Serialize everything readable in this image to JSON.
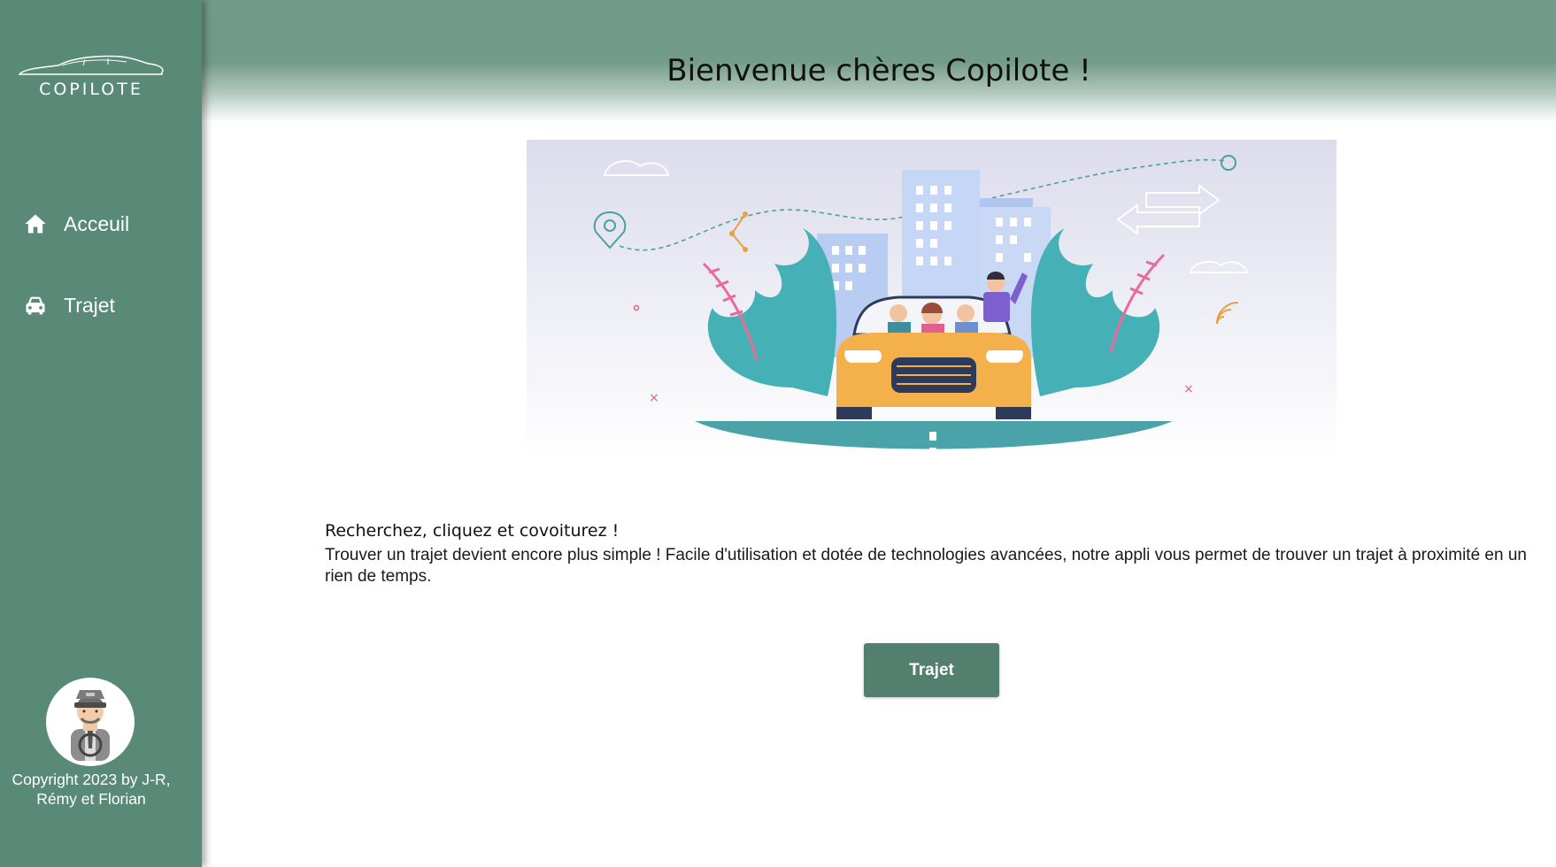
{
  "brand": {
    "logo_text": "COPILOTE"
  },
  "sidebar": {
    "items": [
      {
        "label": "Acceuil",
        "icon": "home-icon"
      },
      {
        "label": "Trajet",
        "icon": "car-icon"
      }
    ],
    "copyright": "Copyright 2023 by J-R, Rémy et Florian"
  },
  "header": {
    "title": "Bienvenue chères Copilote !"
  },
  "main": {
    "tagline": "Recherchez, cliquez et covoiturez !",
    "description": "Trouver un trajet devient encore plus simple ! Facile d'utilisation et dotée de technologies avancées, notre appli vous permet de trouver un trajet à proximité en un rien de temps.",
    "cta_label": "Trajet"
  },
  "colors": {
    "sidebar_bg": "#588a77",
    "header_bg": "#739b8b",
    "button_bg": "#537f6f"
  }
}
